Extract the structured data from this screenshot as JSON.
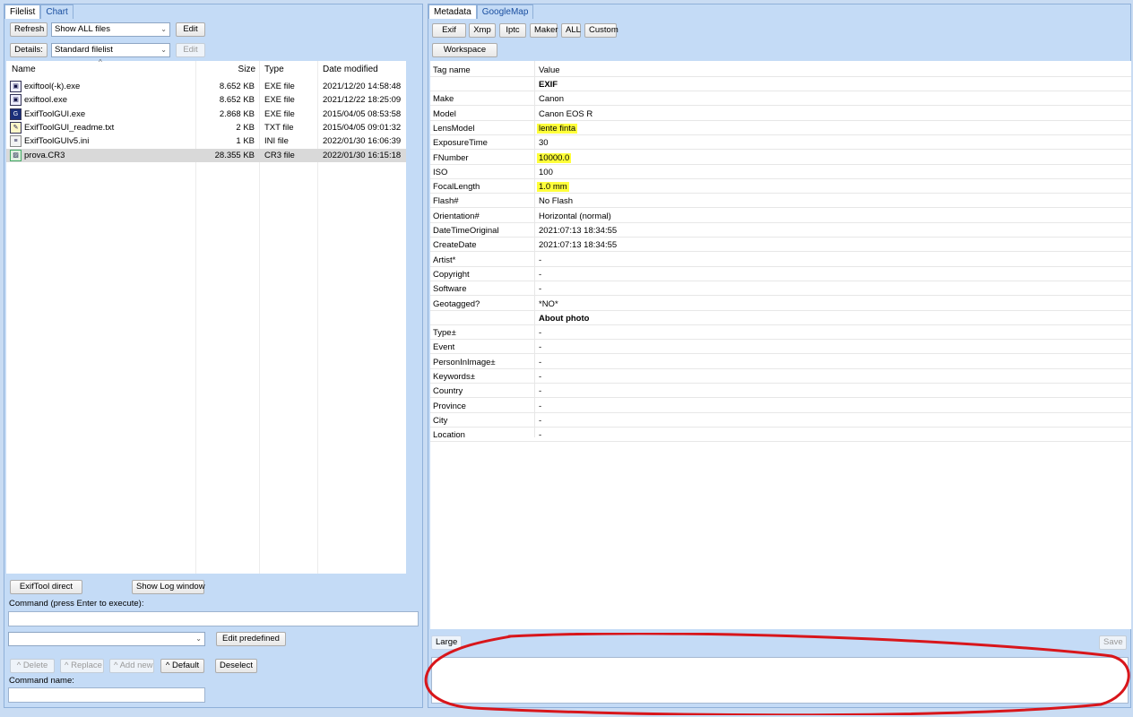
{
  "left_panel": {
    "tabs": [
      "Filelist",
      "Chart"
    ],
    "refresh_label": "Refresh",
    "filter_value": "Show ALL files",
    "edit_label": "Edit",
    "details_label": "Details:",
    "details_value": "Standard filelist",
    "details_edit_label": "Edit",
    "columns": {
      "name": "Name",
      "size": "Size",
      "type": "Type",
      "date": "Date modified"
    },
    "files": [
      {
        "name": "exiftool(-k).exe",
        "size": "8.652 KB",
        "type": "EXE file",
        "date": "2021/12/20 14:58:48",
        "icon": "exe-icon"
      },
      {
        "name": "exiftool.exe",
        "size": "8.652 KB",
        "type": "EXE file",
        "date": "2021/12/22 18:25:09",
        "icon": "exe-icon"
      },
      {
        "name": "ExifToolGUI.exe",
        "size": "2.868 KB",
        "type": "EXE file",
        "date": "2015/04/05 08:53:58",
        "icon": "app-icon"
      },
      {
        "name": "ExifToolGUI_readme.txt",
        "size": "2 KB",
        "type": "TXT file",
        "date": "2015/04/05 09:01:32",
        "icon": "text-file-icon"
      },
      {
        "name": "ExifToolGUIv5.ini",
        "size": "1 KB",
        "type": "INI file",
        "date": "2022/01/30 16:06:39",
        "icon": "ini-file-icon"
      },
      {
        "name": "prova.CR3",
        "size": "28.355 KB",
        "type": "CR3 file",
        "date": "2022/01/30 16:15:18",
        "icon": "image-file-icon"
      }
    ],
    "exiftool_direct_label": "ExifTool direct",
    "show_log_label": "Show Log window",
    "command_label": "Command (press Enter to execute):",
    "edit_predefined_label": "Edit predefined",
    "delete_label": "^ Delete",
    "replace_label": "^ Replace",
    "add_new_label": "^ Add new",
    "default_label": "^ Default",
    "deselect_label": "Deselect",
    "command_name_label": "Command name:"
  },
  "right_panel": {
    "tabs": [
      "Metadata",
      "GoogleMap"
    ],
    "buttons": [
      "Exif",
      "Xmp",
      "Iptc",
      "Maker",
      "ALL",
      "Custom"
    ],
    "workspace_label": "Workspace",
    "columns": {
      "tag": "Tag name",
      "value": "Value"
    },
    "rows": [
      {
        "tag": "",
        "value": "EXIF",
        "bold": true
      },
      {
        "tag": "Make",
        "value": "Canon"
      },
      {
        "tag": "Model",
        "value": "Canon EOS R"
      },
      {
        "tag": "LensModel",
        "value": "lente finta",
        "highlight": true
      },
      {
        "tag": "ExposureTime",
        "value": "30"
      },
      {
        "tag": "FNumber",
        "value": "10000.0",
        "highlight": true
      },
      {
        "tag": "ISO",
        "value": "100"
      },
      {
        "tag": "FocalLength",
        "value": "1.0 mm",
        "highlight": true
      },
      {
        "tag": "Flash#",
        "value": "No Flash"
      },
      {
        "tag": "Orientation#",
        "value": "Horizontal (normal)"
      },
      {
        "tag": "DateTimeOriginal",
        "value": "2021:07:13 18:34:55"
      },
      {
        "tag": "CreateDate",
        "value": "2021:07:13 18:34:55"
      },
      {
        "tag": "Artist*",
        "value": "-"
      },
      {
        "tag": "Copyright",
        "value": "-"
      },
      {
        "tag": "Software",
        "value": "-"
      },
      {
        "tag": "Geotagged?",
        "value": "*NO*"
      },
      {
        "tag": "",
        "value": "About photo",
        "bold": true
      },
      {
        "tag": "Type±",
        "value": "-"
      },
      {
        "tag": "Event",
        "value": "-"
      },
      {
        "tag": "PersonInImage±",
        "value": "-"
      },
      {
        "tag": "Keywords±",
        "value": "-"
      },
      {
        "tag": "Country",
        "value": "-"
      },
      {
        "tag": "Province",
        "value": "-"
      },
      {
        "tag": "City",
        "value": "-"
      },
      {
        "tag": "Location",
        "value": "-"
      }
    ],
    "large_label": "Large",
    "save_label": "Save"
  },
  "colors": {
    "highlight": "#ffff3a",
    "annotation": "#d8161b",
    "selected_row": "#d9d9d9"
  }
}
